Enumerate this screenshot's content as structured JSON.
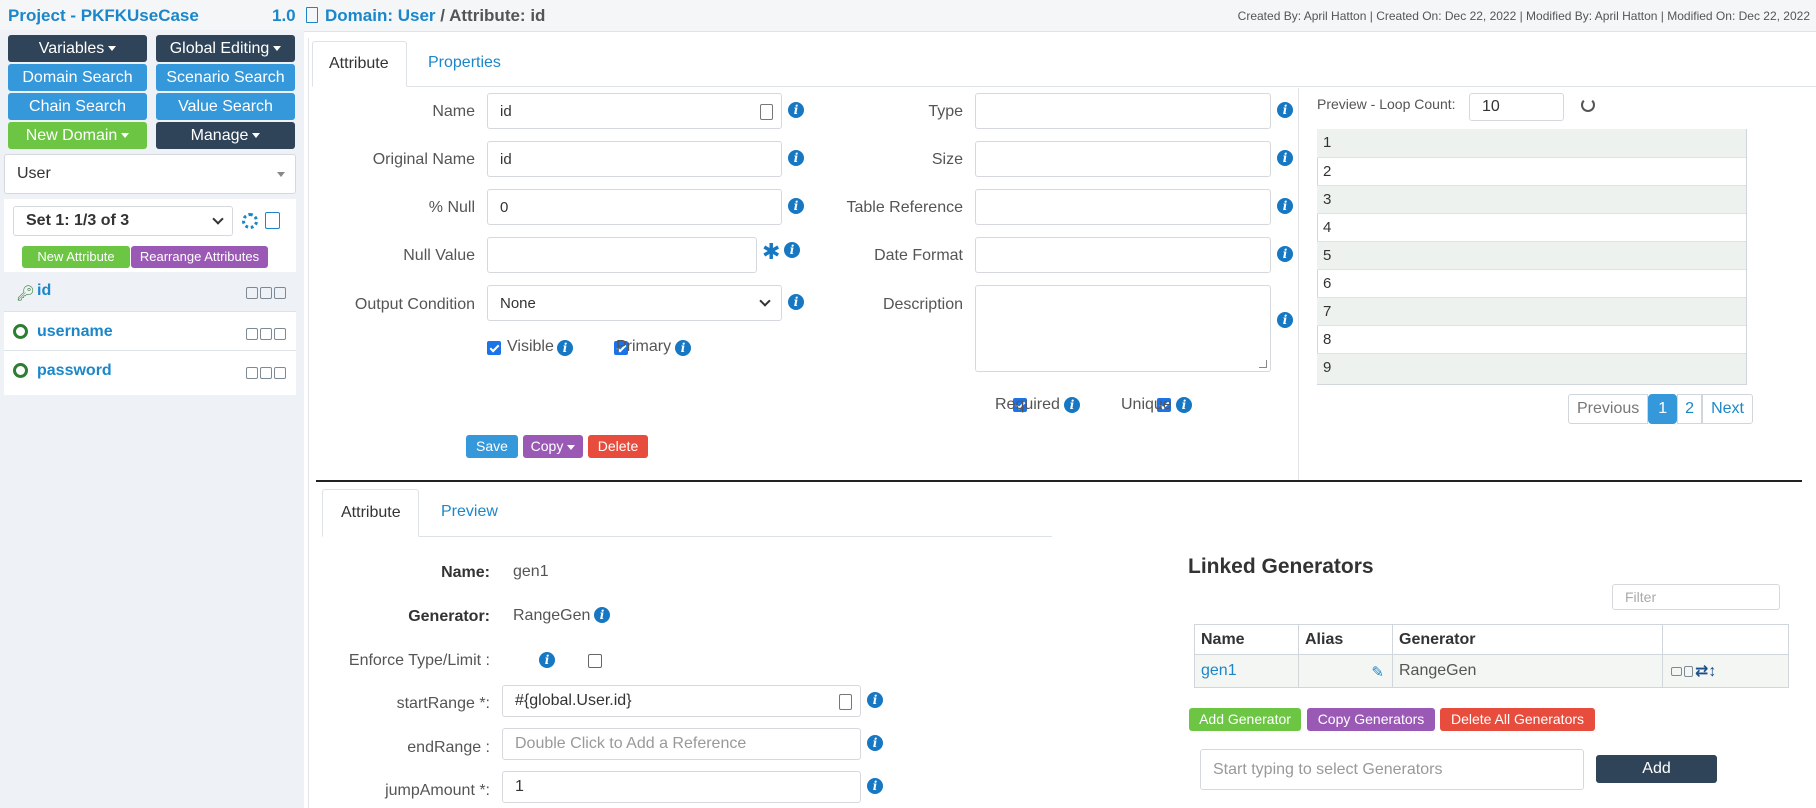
{
  "header": {
    "project": "Project - PKFKUseCase",
    "version": "1.0",
    "crumb_domain_prefix": "Domain:",
    "crumb_domain": "User",
    "crumb_sep": "/",
    "crumb_attr": "Attribute: id",
    "meta": "Created By: April Hatton | Created On: Dec 22, 2022 | Modified By: April Hatton | Modified On: Dec 22, 2022"
  },
  "sidebar": {
    "buttons": {
      "variables": "Variables",
      "global_editing": "Global Editing",
      "domain_search": "Domain Search",
      "scenario_search": "Scenario Search",
      "chain_search": "Chain Search",
      "value_search": "Value Search",
      "new_domain": "New Domain",
      "manage": "Manage"
    },
    "domain_select": "User",
    "set_select": "Set 1: 1/3 of 3",
    "new_attribute": "New Attribute",
    "rearrange": "Rearrange Attributes",
    "attributes": [
      {
        "name": "id",
        "icon": "key-icon"
      },
      {
        "name": "username",
        "icon": "lifebuoy-icon"
      },
      {
        "name": "password",
        "icon": "lifebuoy-icon"
      }
    ]
  },
  "top_tabs": {
    "attribute": "Attribute",
    "properties": "Properties"
  },
  "form": {
    "name_label": "Name",
    "name_value": "id",
    "orig_label": "Original Name",
    "orig_value": "id",
    "null_label": "% Null",
    "null_value": "0",
    "nullval_label": "Null Value",
    "nullval_value": "",
    "outcond_label": "Output Condition",
    "outcond_value": "None",
    "visible_label": "Visible",
    "primary_label": "Primary",
    "type_label": "Type",
    "size_label": "Size",
    "tableref_label": "Table Reference",
    "datefmt_label": "Date Format",
    "desc_label": "Description",
    "required_label": "Required",
    "unique_label": "Unique",
    "save": "Save",
    "copy": "Copy",
    "delete": "Delete"
  },
  "preview": {
    "loop_label": "Preview - Loop Count:",
    "loop_value": "10",
    "rows": [
      "1",
      "2",
      "3",
      "4",
      "5",
      "6",
      "7",
      "8",
      "9"
    ],
    "prev": "Previous",
    "page1": "1",
    "page2": "2",
    "next": "Next"
  },
  "bottom_tabs": {
    "attribute": "Attribute",
    "preview": "Preview"
  },
  "generator": {
    "name_label": "Name:",
    "name_value": "gen1",
    "gen_label": "Generator:",
    "gen_value": "RangeGen",
    "enforce_label": "Enforce Type/Limit :",
    "start_label": "startRange *:",
    "start_value": "#{global.User.id}",
    "end_label": "endRange :",
    "end_placeholder": "Double Click to Add a Reference",
    "jump_label": "jumpAmount *:",
    "jump_value": "1"
  },
  "linked": {
    "title": "Linked Generators",
    "filter_placeholder": "Filter",
    "columns": [
      "Name",
      "Alias",
      "Generator"
    ],
    "rows": [
      {
        "name": "gen1",
        "alias": "",
        "generator": "RangeGen"
      }
    ],
    "add_gen": "Add Generator",
    "copy_gens": "Copy Generators",
    "delete_all": "Delete All Generators",
    "select_placeholder": "Start typing to select Generators",
    "add": "Add"
  },
  "colors": {
    "accent": "#1b87c9",
    "dark": "#2f4459",
    "green": "#6cc644",
    "purple": "#9b59b6",
    "red": "#e74c3c"
  }
}
